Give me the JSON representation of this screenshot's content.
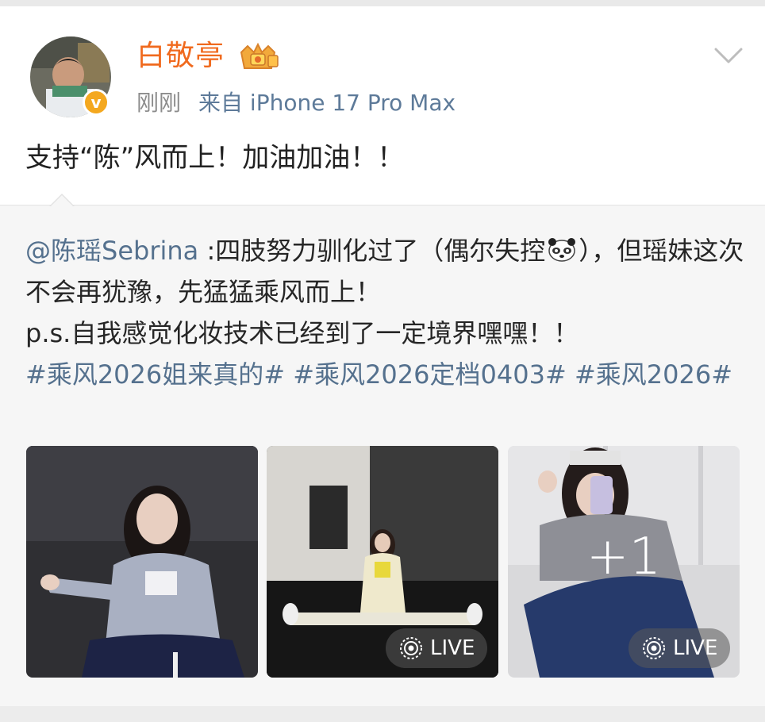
{
  "post": {
    "username": "白敬亭",
    "time": "刚刚",
    "source": "来自 iPhone 17 Pro Max",
    "text": "支持“陈”风而上！加油加油！！",
    "avatar_badge": "v",
    "icons": [
      "crown-badge-icon",
      "chevron-down-icon",
      "verified-badge-icon"
    ]
  },
  "repost": {
    "mention": "@陈瑶Sebrina",
    "text_part1": " :四肢努力驯化过了（偶尔失控",
    "text_part2": "），但瑶妹这次不会再犹豫，先猛猛乘风而上！",
    "line2": "p.s.自我感觉化妆技术已经到了一定境界嘿嘿！！",
    "tags": [
      "#乘风2026姐来真的#",
      "#乘风2026定档0403#",
      "#乘风2026#"
    ],
    "emoji_icon": "panda-emoji-icon"
  },
  "images": {
    "live_label": "LIVE",
    "more_count": "+1"
  },
  "colors": {
    "username": "#f06a1e",
    "link": "#55718e",
    "meta": "#8c8c8c"
  }
}
